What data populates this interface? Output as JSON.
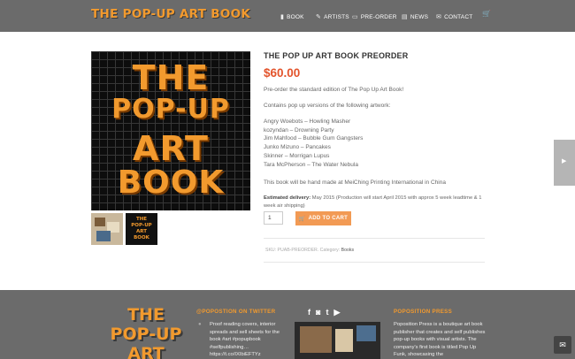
{
  "header": {
    "logo": "THE POP-UP ART BOOK",
    "nav": [
      {
        "icon": "book-icon",
        "glyph": "▮",
        "label": "BOOK"
      },
      {
        "icon": "brush-icon",
        "glyph": "✎",
        "label": "ARTISTS"
      },
      {
        "icon": "card-icon",
        "glyph": "▭",
        "label": "PRE-ORDER"
      },
      {
        "icon": "news-icon",
        "glyph": "▤",
        "label": "NEWS"
      },
      {
        "icon": "envelope-icon",
        "glyph": "✉",
        "label": "CONTACT"
      }
    ],
    "cart_glyph": "🛒"
  },
  "product": {
    "cover_lines": [
      "THE",
      "POP-UP",
      "ART",
      "BOOK"
    ],
    "thumb_title": "THE POP-UP ART BOOK",
    "title": "THE POP UP ART BOOK PREORDER",
    "price": "$60.00",
    "intro": "Pre-order the standard edition of The Pop Up Art Book!",
    "contains": "Contains pop up versions of the following artwork:",
    "artworks": [
      "Angry Woebots – Howling Masher",
      "kozyndan – Drowning Party",
      "Jim Mahfood – Bubble Gum Gangsters",
      "Junko Mizuno – Pancakes",
      "Skinner – Morrigan Lupus",
      "Tara McPherson – The Water Nebula"
    ],
    "made": "This book will be hand made at MeiChing Printing International in China",
    "delivery_label": "Estimated delivery:",
    "delivery_text": " May 2015 (Production will start April 2015 with approx 5 week leadtime & 1 week air shipping)",
    "quantity": "1",
    "add_to_cart": "ADD TO CART",
    "sku_label": "SKU: PUAB-PREORDER. Category: ",
    "category": "Books"
  },
  "footer": {
    "logo_lines": [
      "THE",
      "POP-UP",
      "ART"
    ],
    "twitter_heading": "@POPOSTION ON TWITTER",
    "tweet": "Proof reading covers, interior spreads and sell sheets for the book #art #popupbook #selfpublishing… https://t.co/IXIbiEFTYz",
    "social": [
      "f",
      "◙",
      "t",
      "▶"
    ],
    "press_heading": "POPOSITION PRESS",
    "about": "Poposition Press is a boutique art book publisher that creates and self publishes pop-up books with visual artists. The company's first book is titled Pop Up Funk, showcasing the"
  },
  "widgets": {
    "side_arrow": "▶",
    "mail_glyph": "✉"
  }
}
